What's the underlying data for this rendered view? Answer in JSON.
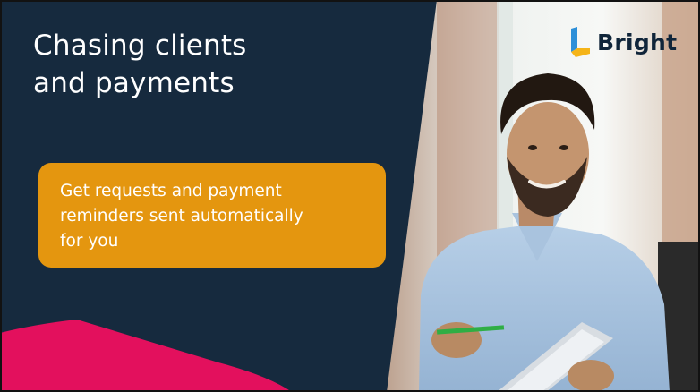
{
  "slide": {
    "headline_lines": [
      "Chasing clients",
      "and payments"
    ],
    "callout_lines": [
      "Get requests and payment",
      "reminders sent automatically",
      "for you"
    ],
    "logo_text": "Bright",
    "colors": {
      "navy": "#162a3e",
      "orange": "#e4960f",
      "pink": "#e3105d",
      "logo_blue": "#2d8fd8",
      "logo_yellow": "#f5b418",
      "white": "#ffffff"
    },
    "photo_subject": "smiling man in light blue shirt holding a pen and tablet"
  }
}
